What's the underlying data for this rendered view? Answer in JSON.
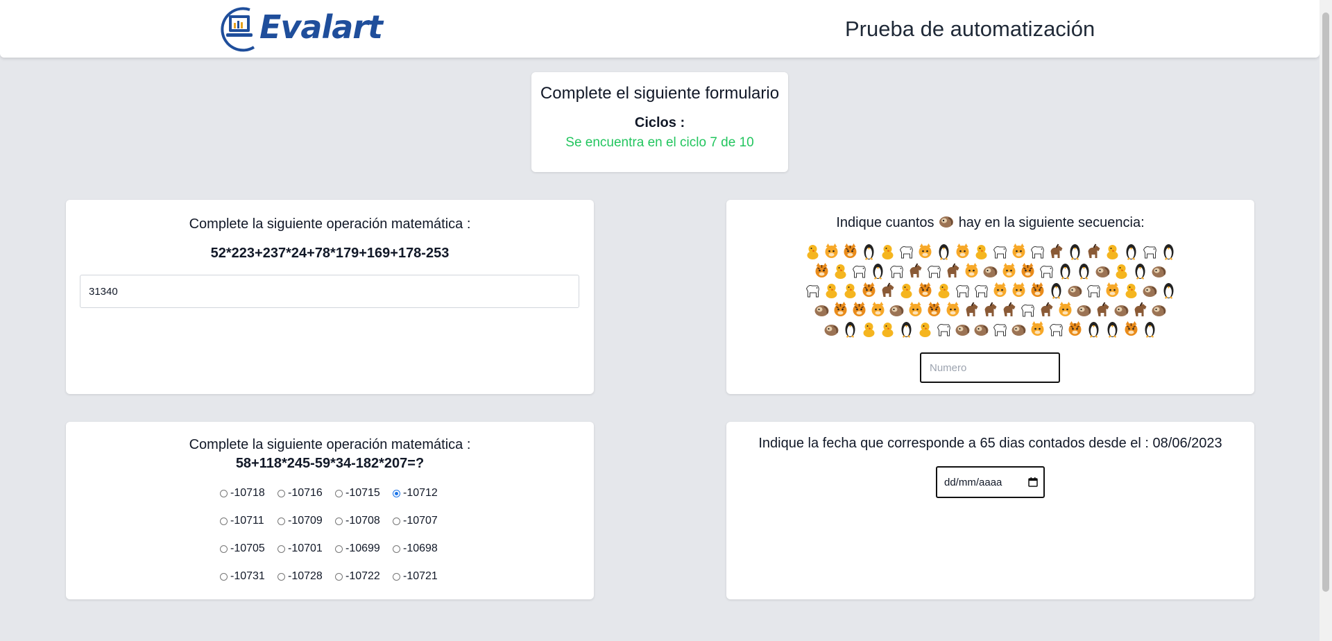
{
  "header": {
    "logo_text": "Evalart",
    "title": "Prueba de automatización"
  },
  "summary": {
    "title": "Complete el siguiente formulario",
    "cycles_label": "Ciclos :",
    "cycle_status": "Se encuentra en el ciclo 7 de 10"
  },
  "math_text": {
    "label": "Complete la siguiente operación matemática :",
    "expression": "52*223+237*24+78*179+169+178-253",
    "answer_value": "31340"
  },
  "emoji_count": {
    "label_before": "Indique cuantos",
    "target_emoji": "sloth",
    "label_after": "hay en la siguiente secuencia:",
    "placeholder": "Numero",
    "sequence": [
      [
        "chick",
        "cat",
        "tiger",
        "penguin",
        "chick",
        "dog",
        "cat",
        "penguin",
        "cat",
        "chick",
        "dog",
        "cat",
        "dog",
        "horse",
        "penguin",
        "horse",
        "chick",
        "penguin",
        "dog",
        "penguin"
      ],
      [
        "tiger",
        "chick",
        "dog",
        "penguin",
        "dog",
        "horse",
        "dog",
        "horse",
        "cat",
        "sloth",
        "cat",
        "tiger",
        "dog",
        "penguin",
        "penguin",
        "sloth",
        "chick",
        "penguin",
        "sloth"
      ],
      [
        "dog",
        "chick",
        "chick",
        "tiger",
        "horse",
        "chick",
        "tiger",
        "chick",
        "dog",
        "dog",
        "cat",
        "cat",
        "tiger",
        "penguin",
        "sloth",
        "dog",
        "cat",
        "chick",
        "sloth",
        "penguin"
      ],
      [
        "sloth",
        "tiger",
        "tiger",
        "cat",
        "sloth",
        "cat",
        "tiger",
        "cat",
        "horse",
        "horse",
        "horse",
        "dog",
        "horse",
        "cat",
        "sloth",
        "horse",
        "sloth",
        "horse",
        "sloth"
      ],
      [
        "sloth",
        "penguin",
        "chick",
        "chick",
        "penguin",
        "chick",
        "dog",
        "sloth",
        "sloth",
        "dog",
        "sloth",
        "cat",
        "dog",
        "tiger",
        "penguin",
        "penguin",
        "tiger",
        "penguin"
      ]
    ],
    "colors": {
      "chick": "#f5b51f",
      "cat": "#f7a828",
      "tiger": "#e98b1a",
      "penguin": "#222222",
      "dog": "#ffffff",
      "horse": "#8a5a36",
      "sloth": "#9b7354"
    }
  },
  "math_radio": {
    "label": "Complete la siguiente operación matemática :",
    "expression": "58+118*245-59*34-182*207=?",
    "options": [
      "-10718",
      "-10716",
      "-10715",
      "-10712",
      "-10711",
      "-10709",
      "-10708",
      "-10707",
      "-10705",
      "-10701",
      "-10699",
      "-10698",
      "-10731",
      "-10728",
      "-10722",
      "-10721"
    ],
    "selected": "-10712"
  },
  "date_question": {
    "label": "Indique la fecha que corresponde a 65 dias contados desde el : 08/06/2023",
    "placeholder": "dd/mm/aaaa",
    "icon": "calendar-icon"
  }
}
